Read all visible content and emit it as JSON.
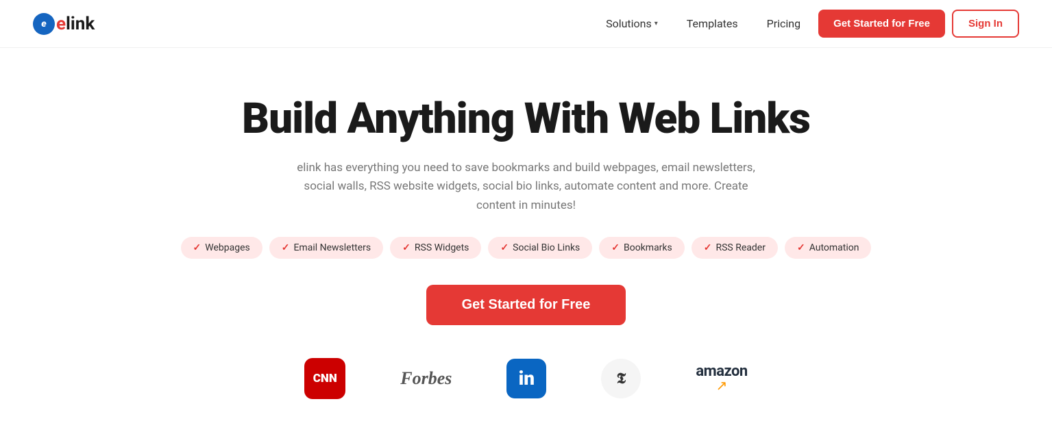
{
  "brand": {
    "logo_letter": "e",
    "logo_word_pre": "e",
    "logo_word_post": "link"
  },
  "nav": {
    "solutions_label": "Solutions",
    "templates_label": "Templates",
    "pricing_label": "Pricing",
    "get_started_label": "Get Started for Free",
    "sign_in_label": "Sign In"
  },
  "hero": {
    "title": "Build Anything With Web Links",
    "subtitle": "elink has everything you need to save bookmarks and build webpages, email newsletters, social walls, RSS website widgets, social bio links, automate content and more. Create content in minutes!",
    "cta_label": "Get Started for Free"
  },
  "feature_tags": [
    {
      "label": "Webpages"
    },
    {
      "label": "Email Newsletters"
    },
    {
      "label": "RSS Widgets"
    },
    {
      "label": "Social Bio Links"
    },
    {
      "label": "Bookmarks"
    },
    {
      "label": "RSS Reader"
    },
    {
      "label": "Automation"
    }
  ],
  "logos": [
    {
      "name": "CNN",
      "type": "cnn"
    },
    {
      "name": "Forbes",
      "type": "forbes"
    },
    {
      "name": "in",
      "type": "linkedin"
    },
    {
      "name": "T",
      "type": "nyt"
    },
    {
      "name": "amazon",
      "type": "amazon"
    }
  ],
  "colors": {
    "accent": "#e53935",
    "nav_bg": "#ffffff",
    "text_dark": "#1a1a1a",
    "text_muted": "#777777"
  }
}
